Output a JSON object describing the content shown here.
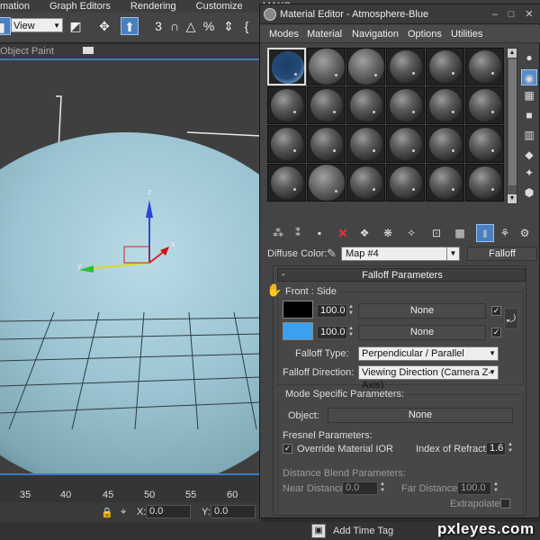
{
  "main_menu": [
    "mation",
    "Graph Editors",
    "Rendering",
    "Customize",
    "MAXS"
  ],
  "toolbar": {
    "view_select": "View",
    "icons": [
      "rotate-icon",
      "link-icon",
      "move-icon",
      "select-region-icon",
      "snap-3-icon",
      "angle-snap-icon",
      "percent-snap-icon",
      "spinner-snap-icon"
    ]
  },
  "viewport": {
    "label": "Object Paint",
    "axis_z": "z",
    "axis_y": "y",
    "axis_x": "x"
  },
  "timeline": {
    "ticks": [
      "35",
      "40",
      "45",
      "50",
      "55",
      "60"
    ]
  },
  "status": {
    "x_label": "X:",
    "x_value": "0.0",
    "y_label": "Y:",
    "y_value": "0.0"
  },
  "bottom": {
    "add_time_tag": "Add Time Tag"
  },
  "watermark": "pxleyes.com",
  "material_editor": {
    "title": "Material Editor - Atmosphere-Blue",
    "menu": [
      "Modes",
      "Material",
      "Navigation",
      "Options",
      "Utilities"
    ],
    "diffuse_label": "Diffuse Color:",
    "map_name": "Map #4",
    "map_type": "Falloff",
    "rollout_title": "Falloff Parameters",
    "rollout_toggle": "-",
    "front_side": {
      "label": "Front : Side",
      "front_color": "#000000",
      "side_color": "#3aa0f0",
      "front_amount": "100.0",
      "side_amount": "100.0",
      "front_map": "None",
      "side_map": "None"
    },
    "falloff_type_label": "Falloff Type:",
    "falloff_type_value": "Perpendicular / Parallel",
    "falloff_direction_label": "Falloff Direction:",
    "falloff_direction_value": "Viewing Direction (Camera Z-Axis)",
    "mode_specific": {
      "label": "Mode Specific Parameters:",
      "object_label": "Object:",
      "object_value": "None",
      "fresnel_label": "Fresnel Parameters:",
      "override_ior": "Override Material IOR",
      "ior_label": "Index of Refraction",
      "ior_value": "1.6",
      "distance_blend_label": "Distance Blend Parameters:",
      "near_label": "Near Distance:",
      "near_value": "0.0",
      "far_label": "Far Distance:",
      "far_value": "100.0",
      "extrapolate": "Extrapolate"
    }
  }
}
